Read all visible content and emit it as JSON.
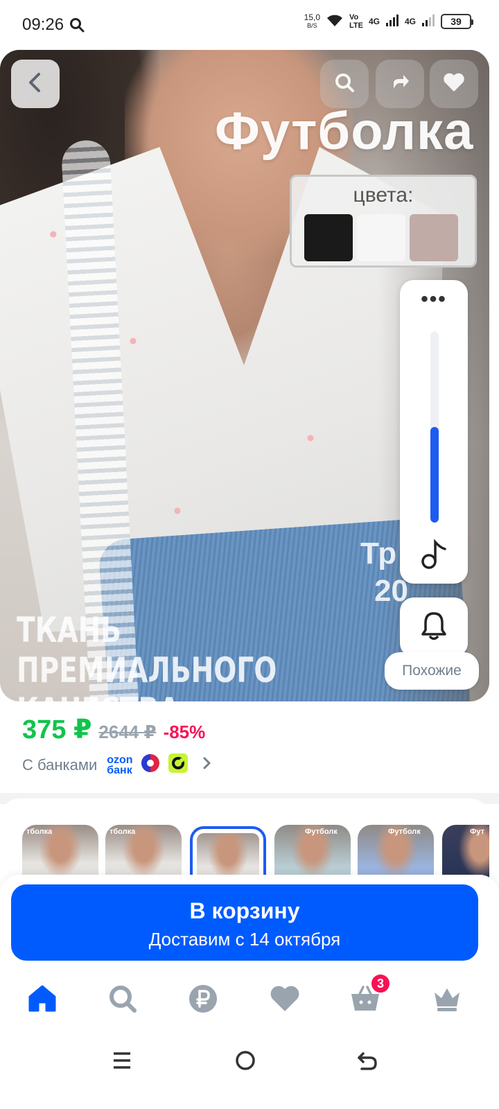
{
  "status_bar": {
    "time": "09:26",
    "net_speed": "15,0",
    "net_speed_unit": "B/S",
    "volte_top": "Vo",
    "volte_bottom": "LTE",
    "net1": "4G",
    "net2": "4G",
    "battery": "39",
    "icons": [
      "search-icon",
      "wifi-icon",
      "signal-icon",
      "signal-icon",
      "battery-icon"
    ]
  },
  "hero": {
    "title": "Футболка",
    "colors_label": "цвета:",
    "colors": [
      "#1a1a1a",
      "#f6f6f7",
      "#c1aba6"
    ],
    "quality_lines": [
      "Ткань",
      "премиального",
      "качества"
    ],
    "trend_lines": [
      "Тр",
      "20"
    ],
    "volume_level": 0.5,
    "similar_label": "Похожие"
  },
  "price": {
    "current": "375 ₽",
    "old": "2644 ₽",
    "discount": "-85%",
    "banks_label": "С банками",
    "ozon_line1": "ozon",
    "ozon_line2": "банк"
  },
  "thumbnails": [
    {
      "label": "тболка",
      "selected": false
    },
    {
      "label": "тболка",
      "selected": false
    },
    {
      "label": "",
      "selected": true
    },
    {
      "label": "Футболк",
      "selected": false
    },
    {
      "label": "Футболк",
      "selected": false
    },
    {
      "label": "Фут",
      "selected": false
    }
  ],
  "cart": {
    "title": "В корзину",
    "subtitle": "Доставим с 14 октября"
  },
  "bottom_nav": {
    "items": [
      "home",
      "search",
      "payments",
      "favorites",
      "cart",
      "profile"
    ],
    "cart_badge": "3",
    "active_color": "#005bff",
    "inactive_color": "#9aa4ae"
  }
}
